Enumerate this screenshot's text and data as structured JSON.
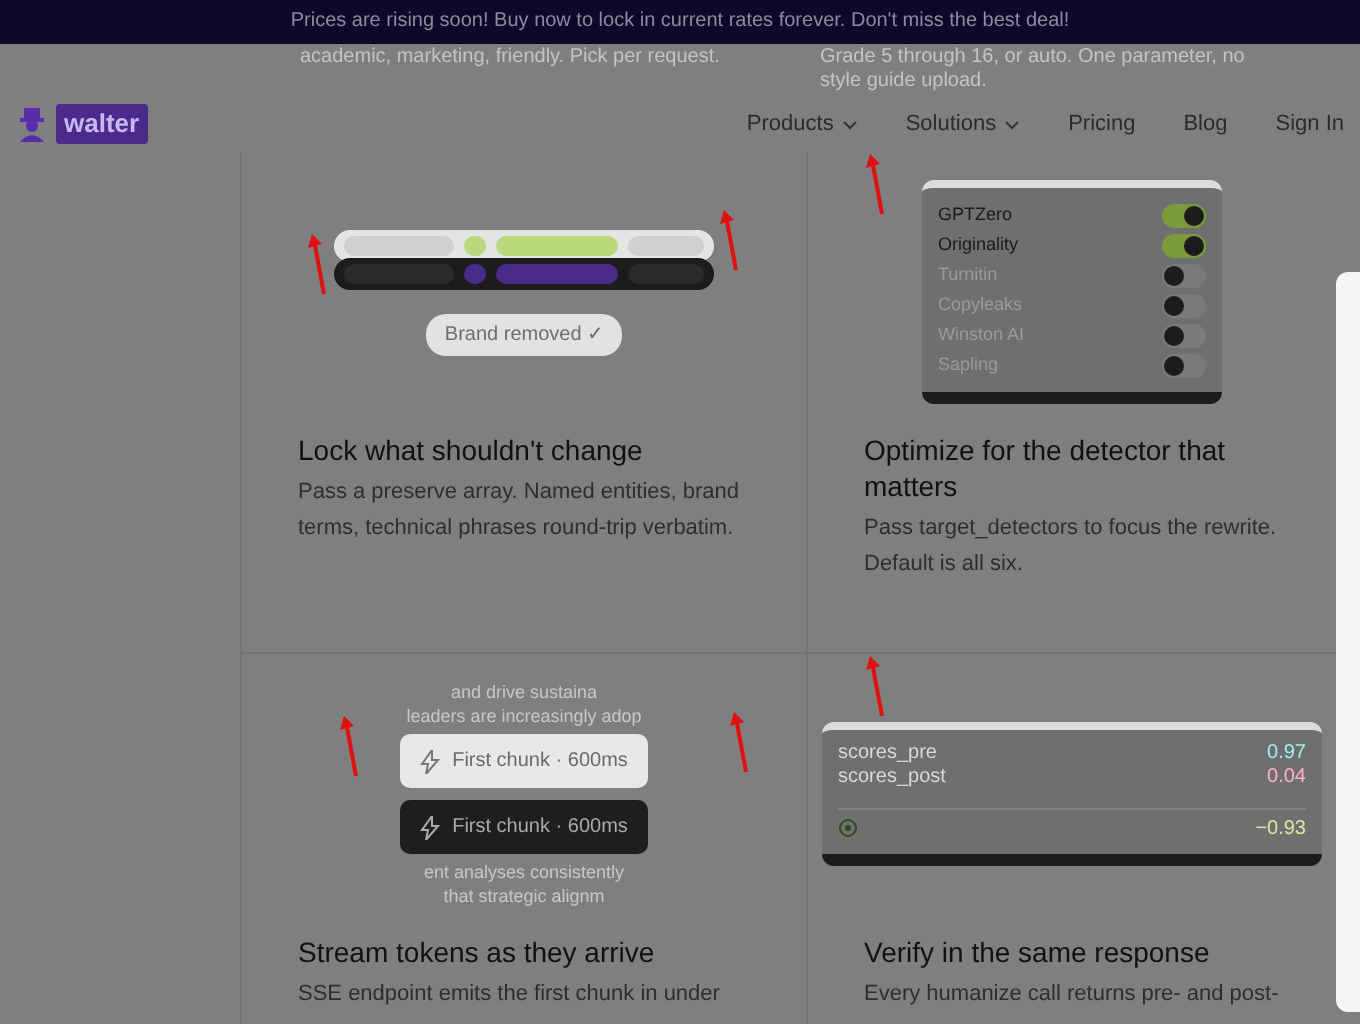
{
  "banner": {
    "text": "Prices are rising soon! Buy now to lock in current rates forever. Don't miss the best deal!"
  },
  "behind_text": [
    "academic, marketing, friendly. Pick per request.",
    "Grade 5 through 16, or auto. One parameter, no style guide upload."
  ],
  "brand": {
    "name": "walter"
  },
  "nav": [
    {
      "label": "Products",
      "dropdown": true
    },
    {
      "label": "Solutions",
      "dropdown": true
    },
    {
      "label": "Pricing",
      "dropdown": false
    },
    {
      "label": "Blog",
      "dropdown": false
    },
    {
      "label": "Sign In",
      "dropdown": false
    }
  ],
  "features": [
    {
      "kind": "preserve",
      "badge": "Brand removed ✓",
      "title": "Lock what shouldn't change",
      "description": "Pass a preserve array. Named entities, brand terms, technical phrases round-trip verbatim."
    },
    {
      "kind": "detectors",
      "title": "Optimize for the detector that matters",
      "description": "Pass target_detectors to focus the rewrite. Default is all six.",
      "detectors": [
        {
          "name": "GPTZero",
          "on": true
        },
        {
          "name": "Originality",
          "on": true
        },
        {
          "name": "Turnitin",
          "on": false
        },
        {
          "name": "Copyleaks",
          "on": false
        },
        {
          "name": "Winston AI",
          "on": false
        },
        {
          "name": "Sapling",
          "on": false
        }
      ]
    },
    {
      "kind": "stream",
      "title": "Stream tokens as they arrive",
      "description": "SSE endpoint emits the first chunk in under",
      "chips": [
        "First chunk · 600ms",
        "First chunk · 600ms"
      ],
      "ghost_lines": [
        "and drive sustaina",
        "leaders are increasingly adop",
        "ent analyses consistently",
        "that strategic alignm"
      ]
    },
    {
      "kind": "scores",
      "title": "Verify in the same response",
      "description": "Every humanize call returns pre- and post-",
      "scores": [
        {
          "label": "scores_pre",
          "value": "0.97",
          "color": "#9ff0e8"
        },
        {
          "label": "scores_post",
          "value": "0.04",
          "color": "#ffb0d0"
        }
      ],
      "delta": "−0.93"
    }
  ]
}
